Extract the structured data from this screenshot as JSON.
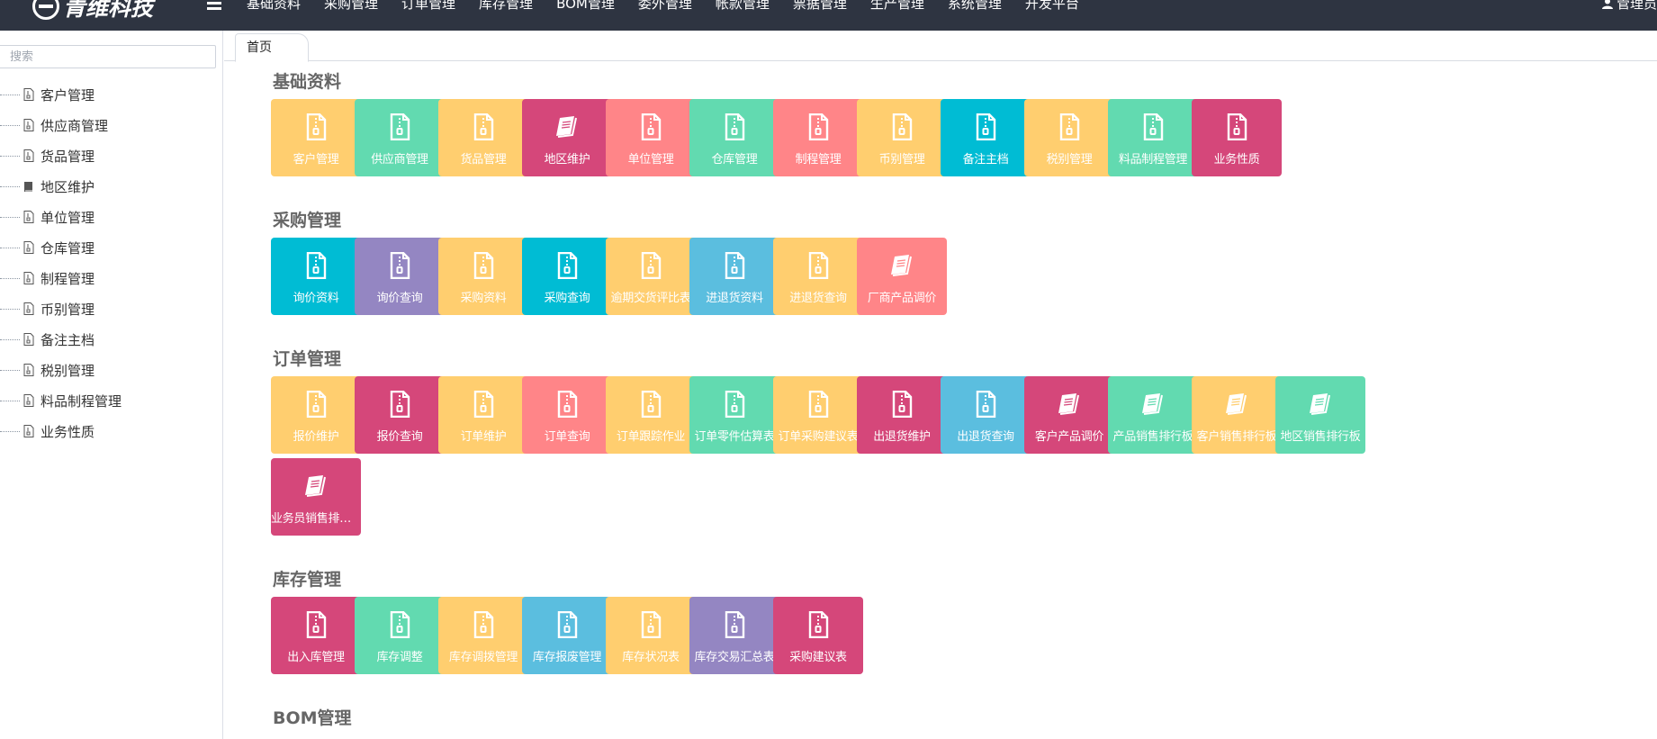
{
  "header": {
    "logo_text": "青维科技",
    "menu_toggle_icon": "hamburger-icon",
    "nav": [
      "基础资料",
      "采购管理",
      "订单管理",
      "库存管理",
      "BOM管理",
      "委外管理",
      "帐款管理",
      "票据管理",
      "生产管理",
      "系统管理",
      "开发平台"
    ],
    "user_icon": "user-icon",
    "user_label": "管理员"
  },
  "sidebar": {
    "search_placeholder": "搜索",
    "items": [
      {
        "label": "客户管理",
        "icon": "file-icon"
      },
      {
        "label": "供应商管理",
        "icon": "file-icon"
      },
      {
        "label": "货品管理",
        "icon": "file-icon"
      },
      {
        "label": "地区维护",
        "icon": "book-icon"
      },
      {
        "label": "单位管理",
        "icon": "file-icon"
      },
      {
        "label": "仓库管理",
        "icon": "file-icon"
      },
      {
        "label": "制程管理",
        "icon": "file-icon"
      },
      {
        "label": "币别管理",
        "icon": "file-icon"
      },
      {
        "label": "备注主档",
        "icon": "file-icon"
      },
      {
        "label": "税别管理",
        "icon": "file-icon"
      },
      {
        "label": "料品制程管理",
        "icon": "file-icon"
      },
      {
        "label": "业务性质",
        "icon": "file-icon"
      }
    ]
  },
  "tabs": [
    {
      "label": "首页"
    }
  ],
  "colors": {
    "topbar": "#2e3441",
    "yellow": "#ffce6f",
    "green": "#62dab0",
    "pink": "#d5477a",
    "salmon": "#ff8588",
    "cyan": "#00bcd4",
    "purple": "#9486c2",
    "blue": "#5bbedf"
  },
  "sections": [
    {
      "title": "基础资料",
      "tiles": [
        {
          "label": "客户管理",
          "color": "yellow",
          "icon": "zip-file-icon"
        },
        {
          "label": "供应商管理",
          "color": "green",
          "icon": "zip-file-icon"
        },
        {
          "label": "货品管理",
          "color": "yellow",
          "icon": "zip-file-icon"
        },
        {
          "label": "地区维护",
          "color": "pink",
          "icon": "book-icon"
        },
        {
          "label": "单位管理",
          "color": "salmon",
          "icon": "zip-file-icon"
        },
        {
          "label": "仓库管理",
          "color": "green",
          "icon": "zip-file-icon"
        },
        {
          "label": "制程管理",
          "color": "salmon",
          "icon": "zip-file-icon"
        },
        {
          "label": "币别管理",
          "color": "yellow",
          "icon": "zip-file-icon"
        },
        {
          "label": "备注主档",
          "color": "cyan",
          "icon": "zip-file-icon"
        },
        {
          "label": "税别管理",
          "color": "yellow",
          "icon": "zip-file-icon"
        },
        {
          "label": "料品制程管理",
          "color": "green",
          "icon": "zip-file-icon"
        },
        {
          "label": "业务性质",
          "color": "pink",
          "icon": "zip-file-icon"
        }
      ]
    },
    {
      "title": "采购管理",
      "tiles": [
        {
          "label": "询价资料",
          "color": "cyan",
          "icon": "zip-file-icon"
        },
        {
          "label": "询价查询",
          "color": "purple",
          "icon": "zip-file-icon"
        },
        {
          "label": "采购资料",
          "color": "yellow",
          "icon": "zip-file-icon"
        },
        {
          "label": "采购查询",
          "color": "cyan",
          "icon": "zip-file-icon"
        },
        {
          "label": "逾期交货评比表",
          "color": "yellow",
          "icon": "zip-file-icon"
        },
        {
          "label": "进退货资料",
          "color": "blue",
          "icon": "zip-file-icon"
        },
        {
          "label": "进退货查询",
          "color": "yellow",
          "icon": "zip-file-icon"
        },
        {
          "label": "厂商产品调价",
          "color": "salmon",
          "icon": "book-icon"
        }
      ]
    },
    {
      "title": "订单管理",
      "tiles": [
        {
          "label": "报价维护",
          "color": "yellow",
          "icon": "zip-file-icon"
        },
        {
          "label": "报价查询",
          "color": "pink",
          "icon": "zip-file-icon"
        },
        {
          "label": "订单维护",
          "color": "yellow",
          "icon": "zip-file-icon"
        },
        {
          "label": "订单查询",
          "color": "salmon",
          "icon": "zip-file-icon"
        },
        {
          "label": "订单跟踪作业",
          "color": "yellow",
          "icon": "zip-file-icon"
        },
        {
          "label": "订单零件估算表",
          "color": "green",
          "icon": "zip-file-icon"
        },
        {
          "label": "订单采购建议表",
          "color": "yellow",
          "icon": "zip-file-icon"
        },
        {
          "label": "出退货维护",
          "color": "pink",
          "icon": "zip-file-icon"
        },
        {
          "label": "出退货查询",
          "color": "blue",
          "icon": "zip-file-icon"
        },
        {
          "label": "客户产品调价",
          "color": "pink",
          "icon": "book-icon"
        },
        {
          "label": "产品销售排行板",
          "color": "green",
          "icon": "book-icon"
        },
        {
          "label": "客户销售排行板",
          "color": "yellow",
          "icon": "book-icon"
        },
        {
          "label": "地区销售排行板",
          "color": "green",
          "icon": "book-icon"
        },
        {
          "label": "业务员销售排行板",
          "color": "pink",
          "icon": "book-icon"
        }
      ]
    },
    {
      "title": "库存管理",
      "tiles": [
        {
          "label": "出入库管理",
          "color": "pink",
          "icon": "zip-file-icon"
        },
        {
          "label": "库存调整",
          "color": "green",
          "icon": "zip-file-icon"
        },
        {
          "label": "库存调拨管理",
          "color": "yellow",
          "icon": "zip-file-icon"
        },
        {
          "label": "库存报废管理",
          "color": "blue",
          "icon": "zip-file-icon"
        },
        {
          "label": "库存状况表",
          "color": "yellow",
          "icon": "zip-file-icon"
        },
        {
          "label": "库存交易汇总表",
          "color": "purple",
          "icon": "zip-file-icon"
        },
        {
          "label": "采购建议表",
          "color": "pink",
          "icon": "zip-file-icon"
        }
      ]
    },
    {
      "title": "BOM管理",
      "tiles": []
    }
  ]
}
